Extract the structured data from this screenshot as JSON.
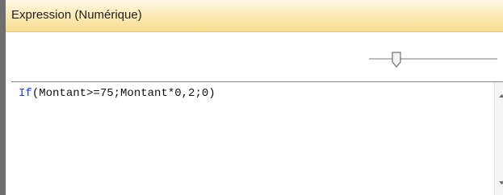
{
  "panel": {
    "title": "Expression (Numérique)"
  },
  "editor": {
    "keyword": "If",
    "expression_rest": "(Montant>=75;Montant*0,2;0)"
  },
  "colors": {
    "title_gradient_top": "#fdf7e4",
    "title_gradient_bottom": "#f8dd8f",
    "keyword": "#1f3fd1",
    "window_border": "#6f6f6f"
  },
  "icons": {
    "slider_thumb": "slider-thumb-icon",
    "scroll_up": "scroll-up-arrow-icon",
    "scroll_down": "scroll-down-arrow-icon"
  }
}
